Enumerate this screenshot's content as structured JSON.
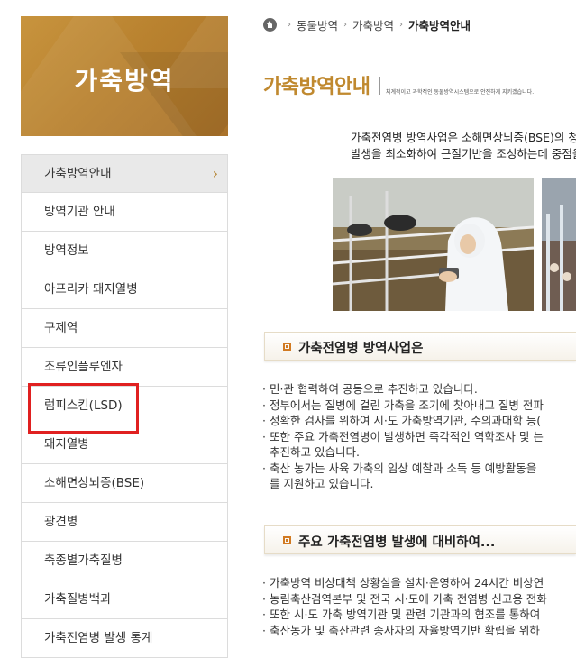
{
  "sidebar": {
    "banner_title": "가축방역",
    "items": [
      {
        "label": "가축방역안내"
      },
      {
        "label": "방역기관 안내"
      },
      {
        "label": "방역정보"
      },
      {
        "label": "아프리카 돼지열병"
      },
      {
        "label": "구제역"
      },
      {
        "label": "조류인플루엔자"
      },
      {
        "label": "럼피스킨(LSD)"
      },
      {
        "label": "돼지열병"
      },
      {
        "label": "소해면상뇌증(BSE)"
      },
      {
        "label": "광견병"
      },
      {
        "label": "축종별가축질병"
      },
      {
        "label": "가축질병백과"
      },
      {
        "label": "가축전염병 발생 통계"
      }
    ],
    "active_arrow": "›"
  },
  "breadcrumb": {
    "items": [
      "동물방역",
      "가축방역",
      "가축방역안내"
    ],
    "separator": "›"
  },
  "page": {
    "title": "가축방역안내",
    "description": "체계적이고 과학적인 동물방역시스템으로 안전하게 지키겠습니다.",
    "intro_line1": "가축전염병 방역사업은 소해면상뇌증(BSE)의 청정",
    "intro_line2": "발생을 최소화하여 근절기반을 조성하는데 중점을"
  },
  "section1": {
    "title": "가축전염병 방역사업은",
    "bullets": [
      "민·관 협력하여 공동으로 추진하고 있습니다.",
      "정부에서는 질병에 걸린 가축을 조기에 찾아내고 질병 전파",
      "정확한 검사를 위하여 시·도 가축방역기관, 수의과대학 등(",
      "또한 주요 가축전염병이 발생하면 즉각적인 역학조사 및 는",
      "추진하고 있습니다.",
      "축산 농가는 사육 가축의 임상 예찰과 소독 등 예방활동을",
      "를 지원하고 있습니다."
    ]
  },
  "section2": {
    "title": "주요 가축전염병 발생에 대비하여...",
    "bullets": [
      "가축방역 비상대책 상황실을 설치·운영하여 24시간 비상연",
      "농림축산검역본부 및 전국 시·도에 가축 전염병 신고용 전화",
      "또한 시·도 가축 방역기관 및 관련 기관과의 협조를 통하여",
      "축산농가 및 축산관련 종사자의 자율방역기반 확립을 위하"
    ]
  },
  "colors": {
    "accent": "#c0892f",
    "highlight": "#e02020",
    "bullet": "#d17a22"
  },
  "icons": {
    "home": "home-icon",
    "section_bullet": "square-bullet-icon"
  }
}
